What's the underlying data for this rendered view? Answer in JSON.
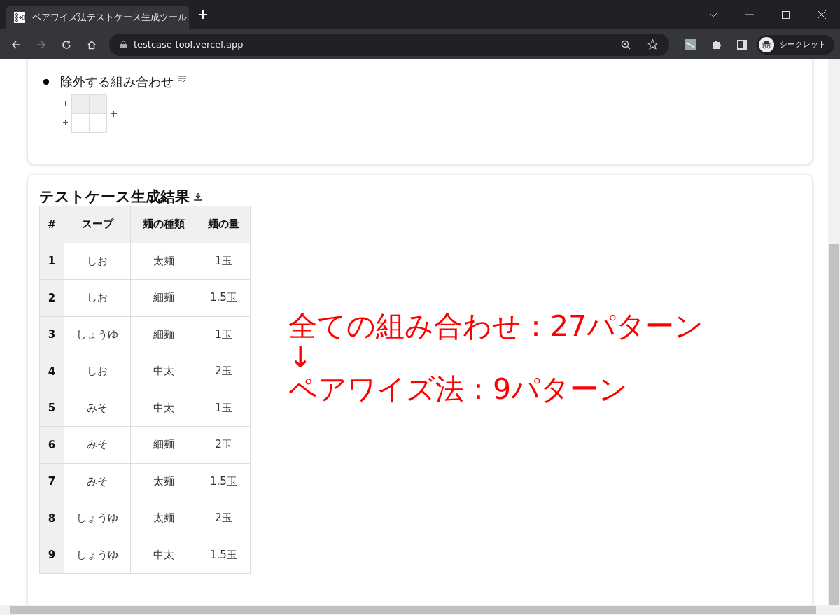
{
  "browser": {
    "tab_title": "ペアワイズ法テストケース生成ツール",
    "address": "testcase-tool.vercel.app",
    "profile_label": "シークレット"
  },
  "exclusions": {
    "label": "除外する組み合わせ"
  },
  "results": {
    "title": "テストケース生成結果",
    "columns": [
      "#",
      "スープ",
      "麺の種類",
      "麺の量"
    ],
    "rows": [
      [
        "1",
        "しお",
        "太麺",
        "1玉"
      ],
      [
        "2",
        "しお",
        "細麺",
        "1.5玉"
      ],
      [
        "3",
        "しょうゆ",
        "細麺",
        "1玉"
      ],
      [
        "4",
        "しお",
        "中太",
        "2玉"
      ],
      [
        "5",
        "みそ",
        "中太",
        "1玉"
      ],
      [
        "6",
        "みそ",
        "細麺",
        "2玉"
      ],
      [
        "7",
        "みそ",
        "太麺",
        "1.5玉"
      ],
      [
        "8",
        "しょうゆ",
        "太麺",
        "2玉"
      ],
      [
        "9",
        "しょうゆ",
        "中太",
        "1.5玉"
      ]
    ]
  },
  "annotation": {
    "lines": [
      "全ての組み合わせ：27パターン",
      "↓",
      "ペアワイズ法：9パターン"
    ]
  }
}
